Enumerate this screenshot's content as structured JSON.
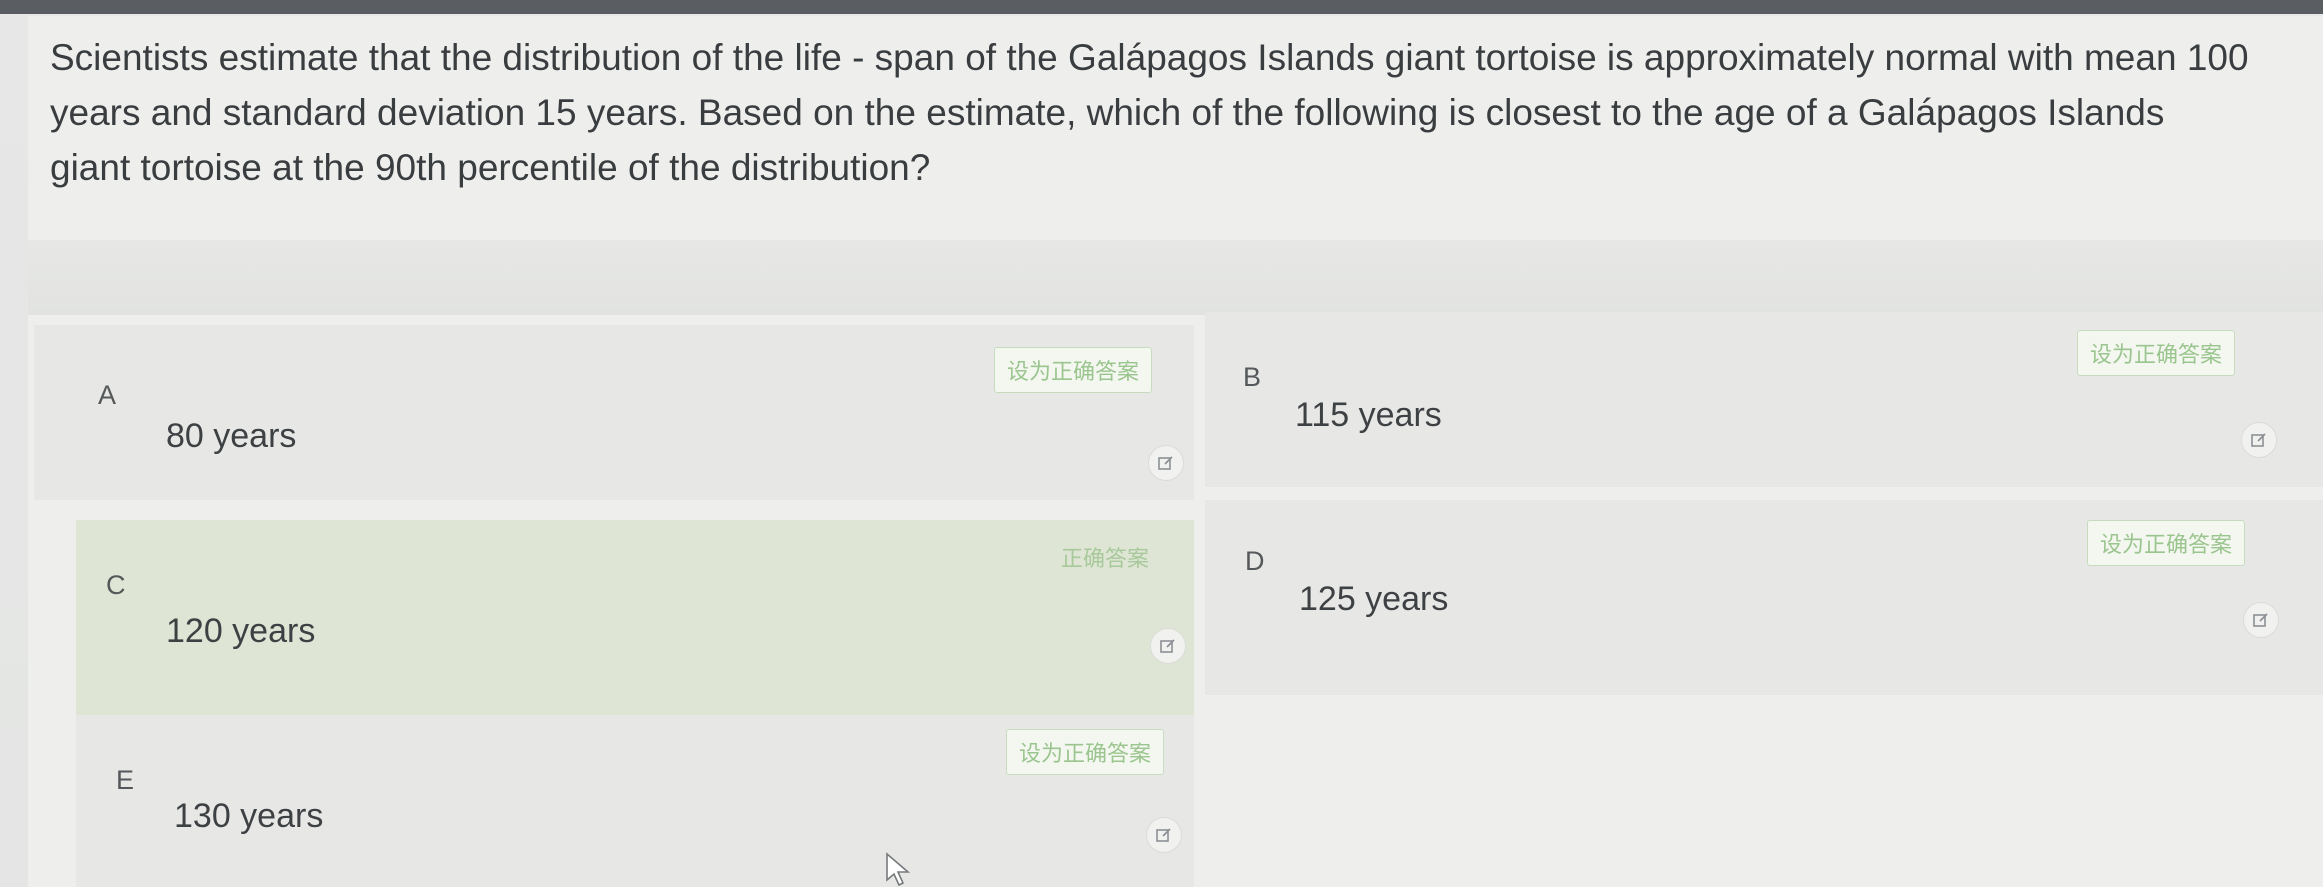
{
  "question": {
    "text": "Scientists estimate that the distribution of the life - span of the Galápagos Islands giant tortoise is approximately normal with mean 100 years and standard deviation 15 years. Based on the estimate, which of the following is closest to the age of a Galápagos Islands giant tortoise at the 90th percentile of the distribution?"
  },
  "options": [
    {
      "letter": "A",
      "text": "80 years",
      "tag": "设为正确答案",
      "correct": false
    },
    {
      "letter": "B",
      "text": "115 years",
      "tag": "设为正确答案",
      "correct": false
    },
    {
      "letter": "C",
      "text": "120 years",
      "tag": "正确答案",
      "correct": true
    },
    {
      "letter": "D",
      "text": "125 years",
      "tag": "设为正确答案",
      "correct": false
    },
    {
      "letter": "E",
      "text": "130 years",
      "tag": "设为正确答案",
      "correct": false
    }
  ],
  "colors": {
    "correct_background": "#dfe5d4",
    "tag_green": "#9bc58e"
  },
  "icons": {
    "edit": "edit-icon",
    "cursor": "mouse-cursor-icon"
  }
}
